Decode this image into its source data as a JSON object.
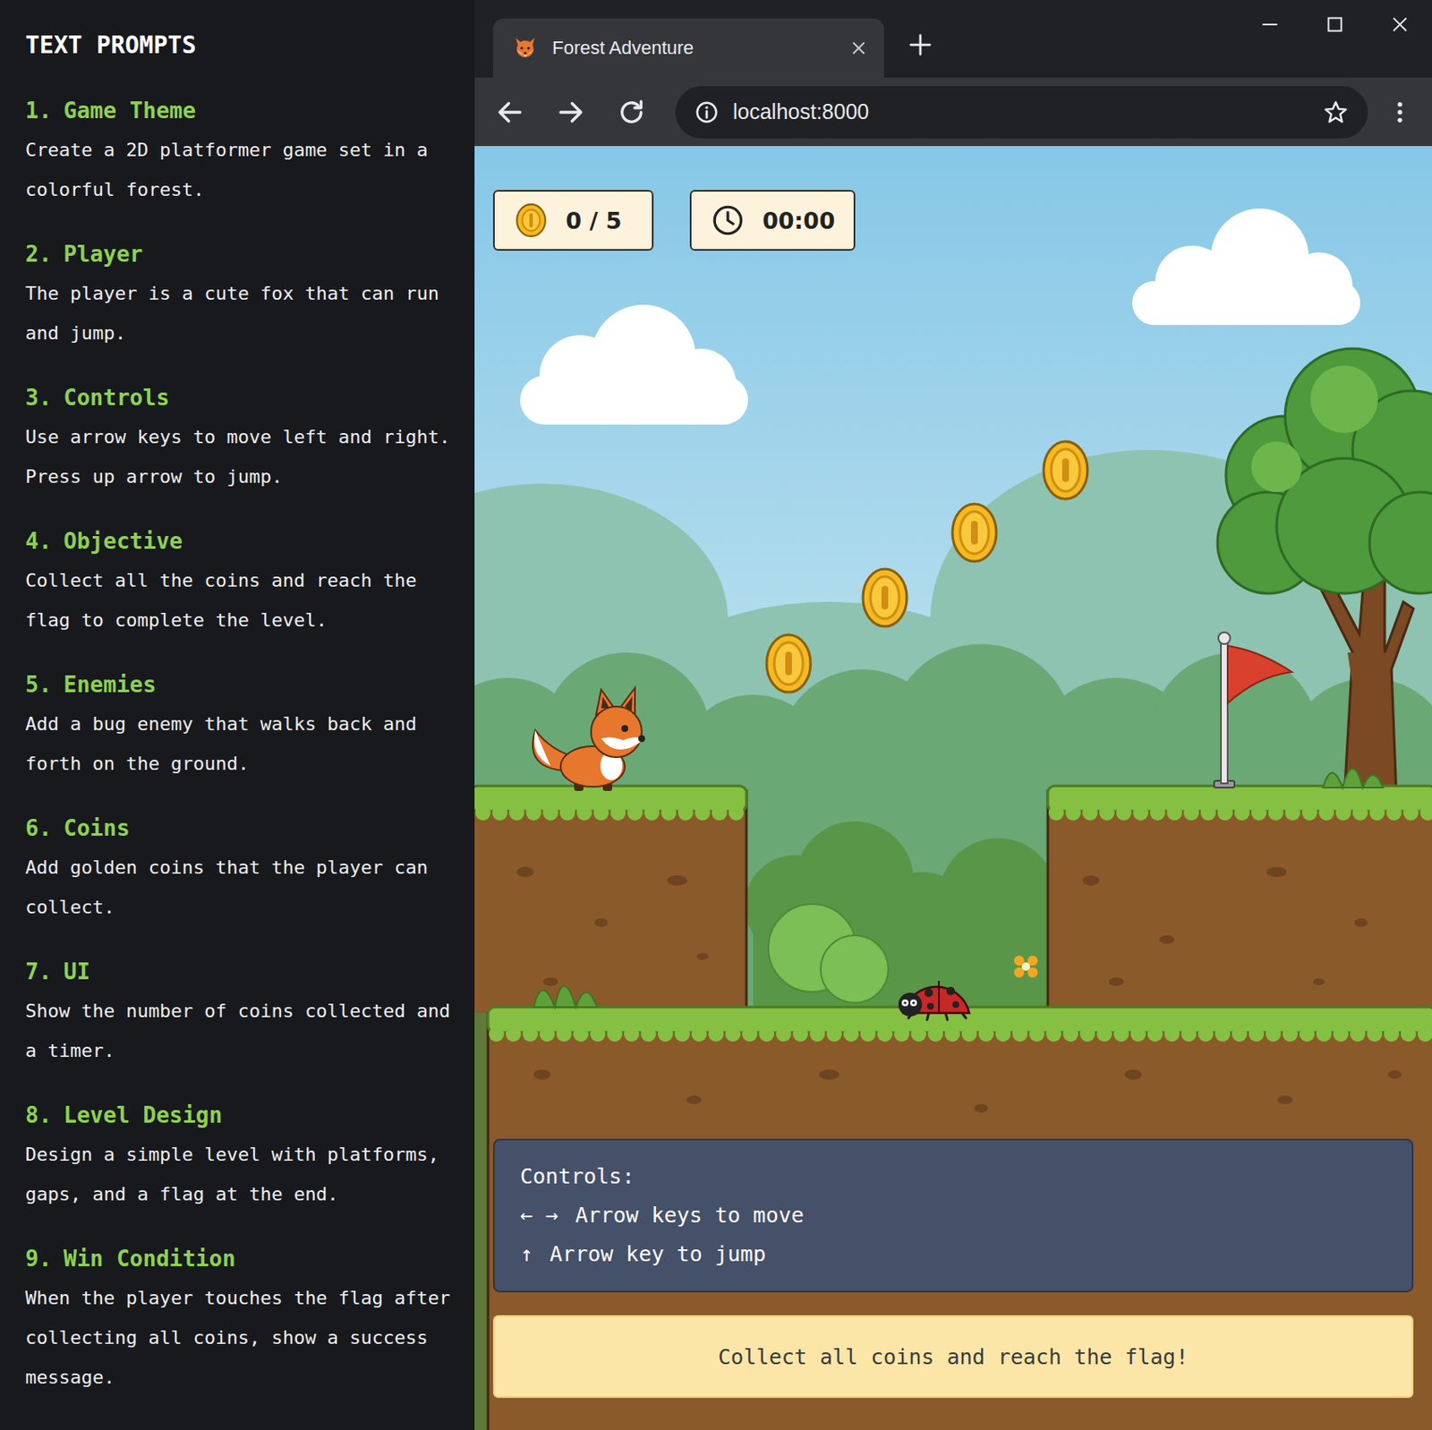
{
  "prompts": {
    "title": "TEXT PROMPTS",
    "items": [
      {
        "number": "1.",
        "heading": "Game Theme",
        "text": "Create a 2D platformer game set in a colorful forest."
      },
      {
        "number": "2.",
        "heading": "Player",
        "text": "The player is a cute fox that can run and jump."
      },
      {
        "number": "3.",
        "heading": "Controls",
        "text": "Use arrow keys to move left and right. Press up arrow to jump."
      },
      {
        "number": "4.",
        "heading": "Objective",
        "text": "Collect all the coins and reach the flag to complete the level."
      },
      {
        "number": "5.",
        "heading": "Enemies",
        "text": "Add a bug enemy that walks back and forth on the ground."
      },
      {
        "number": "6.",
        "heading": "Coins",
        "text": "Add golden coins that the player can collect."
      },
      {
        "number": "7.",
        "heading": "UI",
        "text": "Show the number of coins collected and a timer."
      },
      {
        "number": "8.",
        "heading": "Level Design",
        "text": "Design a simple level with platforms, gaps, and a flag at the end."
      },
      {
        "number": "9.",
        "heading": "Win Condition",
        "text": "When the player touches the flag after collecting all coins, show a success message."
      }
    ]
  },
  "browser": {
    "tab": {
      "title": "Forest Adventure",
      "selected": true
    },
    "address": "localhost:8000"
  },
  "game": {
    "hud": {
      "coins": "0 / 5",
      "timer": "00:00"
    },
    "controls": {
      "title": "Controls:",
      "rows": [
        {
          "keys": "← →",
          "text": "Arrow keys to move"
        },
        {
          "keys": "↑",
          "text": "Arrow key to jump"
        }
      ]
    },
    "message": "Collect all coins and reach the flag!"
  }
}
